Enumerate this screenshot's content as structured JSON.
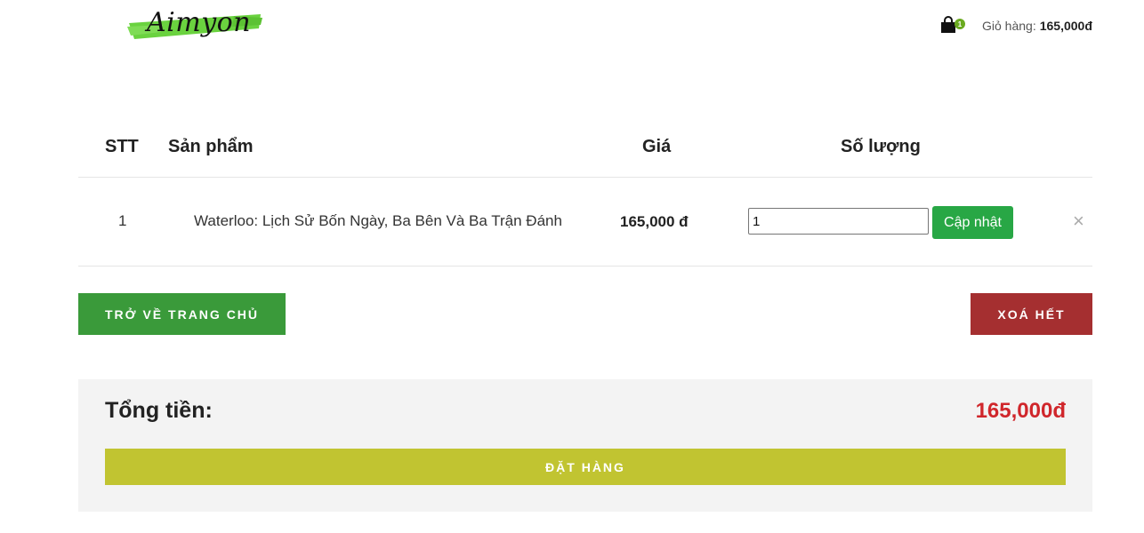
{
  "header": {
    "logo_text": "Aimyon",
    "cart": {
      "icon": "shopping-bag-icon",
      "badge_count": "1",
      "label": "Giỏ hàng:",
      "total": "165,000đ"
    }
  },
  "table": {
    "headers": {
      "stt": "STT",
      "product": "Sản phẩm",
      "price": "Giá",
      "quantity": "Số lượng"
    },
    "rows": [
      {
        "stt": "1",
        "product": "Waterloo: Lịch Sử Bốn Ngày, Ba Bên Và Ba Trận Đánh",
        "price": "165,000 đ",
        "quantity": "1",
        "update_label": "Cập nhật",
        "remove_icon": "close-icon",
        "remove_glyph": "×"
      }
    ]
  },
  "actions": {
    "home_label": "TRỞ VỀ TRANG CHỦ",
    "clear_label": "XOÁ HẾT"
  },
  "summary": {
    "total_label": "Tổng tiền:",
    "total_value": "165,000đ",
    "order_label": "ĐẶT HÀNG"
  },
  "colors": {
    "logo_brush": "#6ad23f",
    "badge": "#6aaa1f",
    "update_button": "#28a745",
    "home_button": "#3a9a3a",
    "clear_button": "#a52f30",
    "total_value": "#d0262b",
    "order_button": "#c1c431",
    "summary_bg": "#f3f3f3"
  }
}
